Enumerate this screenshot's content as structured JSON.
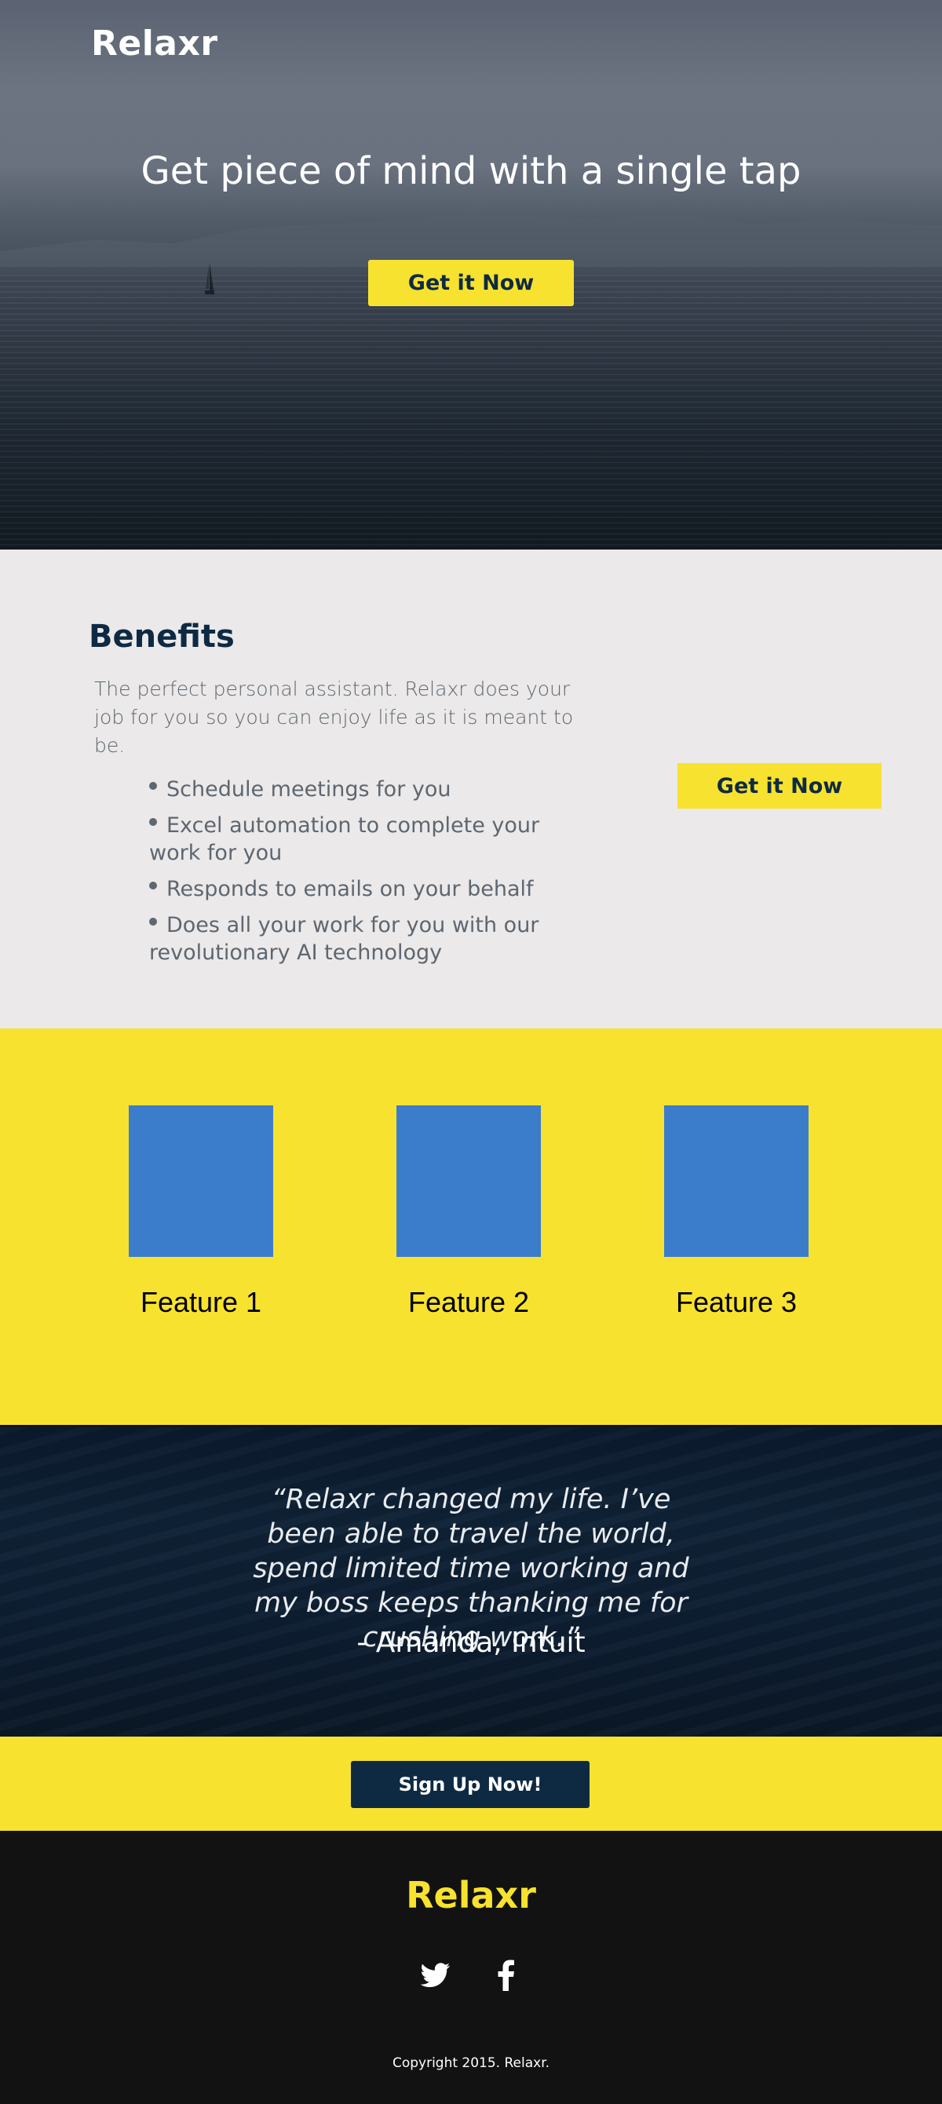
{
  "hero": {
    "logo": "Relaxr",
    "title": "Get piece of mind with a single tap",
    "cta_label": "Get it Now"
  },
  "benefits": {
    "heading": "Benefits",
    "intro": "The perfect personal assistant. Relaxr does your job for you so you can enjoy life as it is meant to be.",
    "items": [
      "Schedule meetings for you",
      "Excel automation to complete your work for you",
      "Responds to emails on your behalf",
      "Does all your work for you with our revolutionary AI technology"
    ],
    "cta_label": "Get it Now"
  },
  "features": {
    "items": [
      {
        "label": "Feature 1"
      },
      {
        "label": "Feature 2"
      },
      {
        "label": "Feature 3"
      }
    ],
    "box_color": "#3b7dcb"
  },
  "testimonial": {
    "quote": "“Relaxr changed my life. I’ve been able to travel the world, spend limited time working and my boss keeps thanking me for crushing work.”",
    "author": "- Amanda, Intuit"
  },
  "signup": {
    "cta_label": "Sign Up Now!"
  },
  "footer": {
    "logo": "Relaxr",
    "social_icons": [
      "twitter-icon",
      "facebook-icon"
    ],
    "copyright": "Copyright 2015. Relaxr."
  },
  "colors": {
    "accent_yellow": "#f7e22f",
    "navy": "#0e2a43",
    "light_gray": "#ebe9e9",
    "footer_black": "#121212"
  }
}
